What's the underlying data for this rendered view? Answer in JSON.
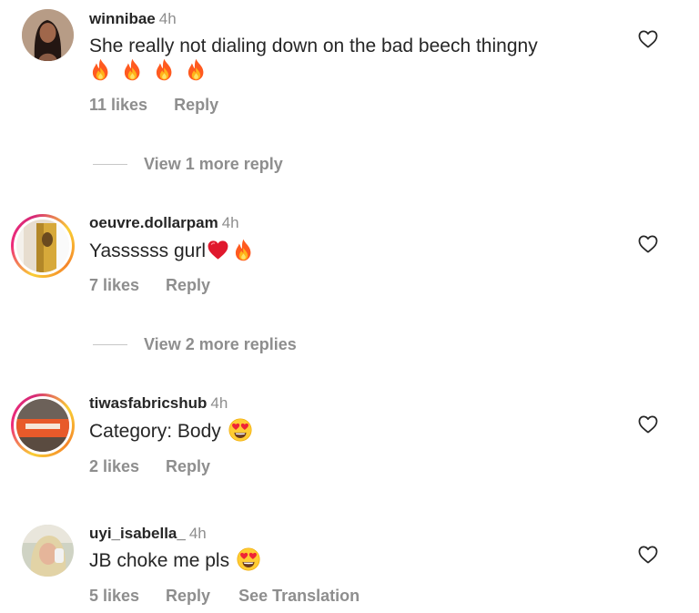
{
  "comments": [
    {
      "username": "winnibae",
      "time": "4h",
      "text": "She really not dialing down on the bad beech thingny",
      "likes": "11 likes",
      "reply": "Reply"
    },
    {
      "username": "oeuvre.dollarpam",
      "time": "4h",
      "text": "Yassssss gurl",
      "likes": "7 likes",
      "reply": "Reply"
    },
    {
      "username": "tiwasfabricshub",
      "time": "4h",
      "text": "Category: Body",
      "likes": "2 likes",
      "reply": "Reply"
    },
    {
      "username": "uyi_isabella_",
      "time": "4h",
      "text": "JB choke me pls",
      "likes": "5 likes",
      "reply": "Reply",
      "translate": "See Translation"
    }
  ],
  "view_replies": [
    "View 1 more reply",
    "View 2 more replies"
  ],
  "icons": {
    "like": "heart-outline-icon",
    "fire": "fire-emoji",
    "red_heart": "red-heart-emoji",
    "heart_eyes": "heart-eyes-emoji"
  },
  "colors": {
    "text": "#262626",
    "secondary": "#8e8e8e",
    "story_ring_start": "#f9ce34",
    "story_ring_mid": "#ee2a7b"
  }
}
